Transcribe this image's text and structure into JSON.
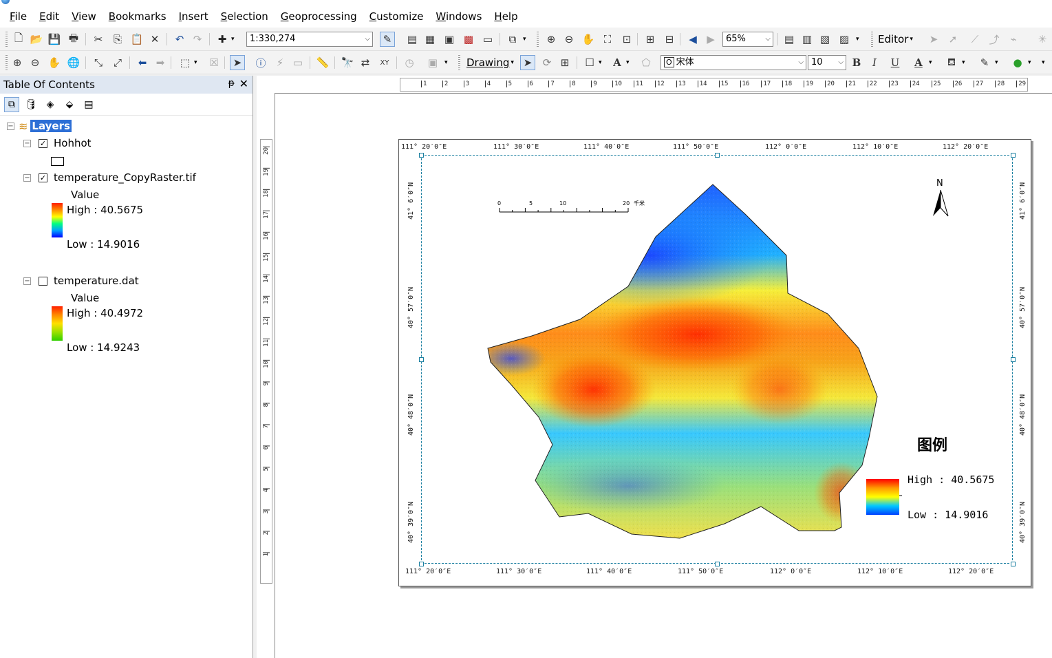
{
  "menu": [
    "File",
    "Edit",
    "View",
    "Bookmarks",
    "Insert",
    "Selection",
    "Geoprocessing",
    "Customize",
    "Windows",
    "Help"
  ],
  "toolbar": {
    "scale": "1:330,274",
    "zoom_percent": "65%",
    "editor_label": "Editor",
    "drawing_label": "Drawing",
    "font_name": "宋体",
    "font_size": "10",
    "bold": "B",
    "italic": "I",
    "underline": "U",
    "text_a": "A"
  },
  "toc": {
    "title": "Table Of Contents",
    "root": "Layers",
    "layers": [
      {
        "name": "Hohhot",
        "checked": true
      },
      {
        "name": "temperature_CopyRaster.tif",
        "checked": true,
        "field": "Value",
        "high": "High : 40.5675",
        "low": "Low : 14.9016"
      },
      {
        "name": "temperature.dat",
        "checked": false,
        "field": "Value",
        "high": "High : 40.4972",
        "low": "Low : 14.9243"
      }
    ]
  },
  "ruler": {
    "h": [
      "1",
      "2",
      "3",
      "4",
      "5",
      "6",
      "7",
      "8",
      "9",
      "10",
      "11",
      "12",
      "13",
      "14",
      "15",
      "16",
      "17",
      "18",
      "19",
      "20",
      "21",
      "22",
      "23",
      "24",
      "25",
      "26",
      "27",
      "28",
      "29"
    ],
    "v": [
      "20",
      "19",
      "18",
      "17",
      "16",
      "15",
      "14",
      "13",
      "12",
      "11",
      "10",
      "9",
      "8",
      "7",
      "6",
      "5",
      "4",
      "3",
      "2",
      "1"
    ]
  },
  "map": {
    "top_coords": [
      "111° 20′0″E",
      "111° 30′0″E",
      "111° 40′0″E",
      "111° 50′0″E",
      "112° 0′0″E",
      "112° 10′0″E",
      "112° 20′0″E"
    ],
    "bottom_coords": [
      "111° 20′0″E",
      "111° 30′0″E",
      "111° 40′0″E",
      "111° 50′0″E",
      "112° 0′0″E",
      "112° 10′0″E",
      "112° 20′0″E"
    ],
    "side_coords": [
      "41° 6′0″N",
      "40° 57′0″N",
      "40° 48′0″N",
      "40° 39′0″N"
    ],
    "scale_labels": [
      "0",
      "5",
      "10",
      "20"
    ],
    "scale_unit": "千米",
    "north": "N",
    "legend_title": "图例",
    "legend_high": "High : 40.5675",
    "legend_low": "Low : 14.9016",
    "colors": {
      "high": "#ff0000",
      "mid": "#ffff00",
      "low": "#0000ff",
      "selection": "#2d6fd6"
    }
  }
}
